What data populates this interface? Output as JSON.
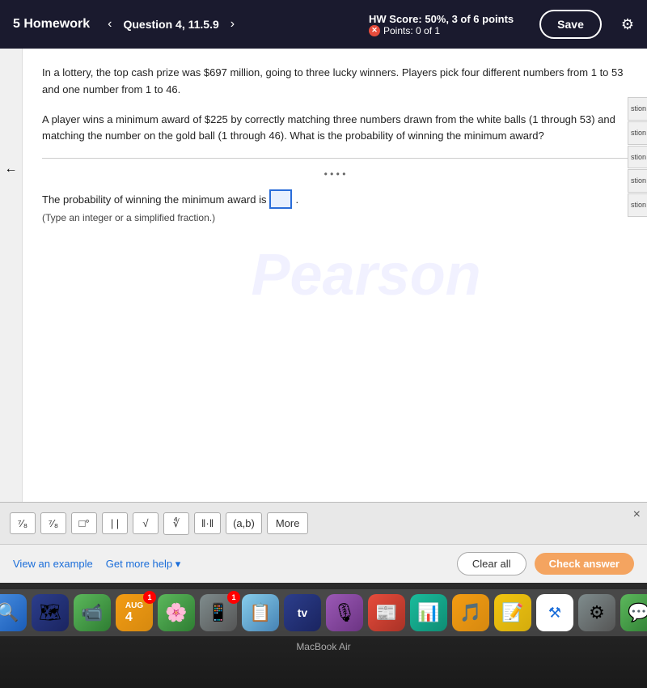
{
  "header": {
    "hw_title": "5 Homework",
    "question_label": "Question 4, 11.5.9",
    "hw_score_label": "HW Score: 50%, 3 of 6 points",
    "points_label": "Points: 0 of 1",
    "save_btn": "Save"
  },
  "problem": {
    "text1": "In a lottery, the top cash prize was $697 million, going to three lucky winners. Players pick four different numbers from 1 to 53 and one number from 1 to 46.",
    "text2": "A player wins a minimum award of $225 by correctly matching three numbers drawn from the white balls (1 through 53) and matching the number on the gold ball (1 through 46). What is the probability of winning the minimum award?",
    "answer_prefix": "The probability of winning the minimum award is",
    "answer_hint": "(Type an integer or a simplified fraction.)"
  },
  "math_toolbar": {
    "buttons": [
      "⁷⁄₈",
      "⁷/₈",
      "□°",
      "| |",
      "√",
      "∜",
      "||",
      "(a,b)"
    ],
    "more_label": "More",
    "close_label": "×"
  },
  "bottom_bar": {
    "view_example": "View an example",
    "get_more_help": "Get more help ▾",
    "clear_all": "Clear all",
    "check_answer": "Check answer"
  },
  "side_tabs": [
    "stion",
    "stion",
    "stion",
    "stion",
    "stion"
  ],
  "watermark": "Pearson",
  "macbook_label": "MacBook Air"
}
